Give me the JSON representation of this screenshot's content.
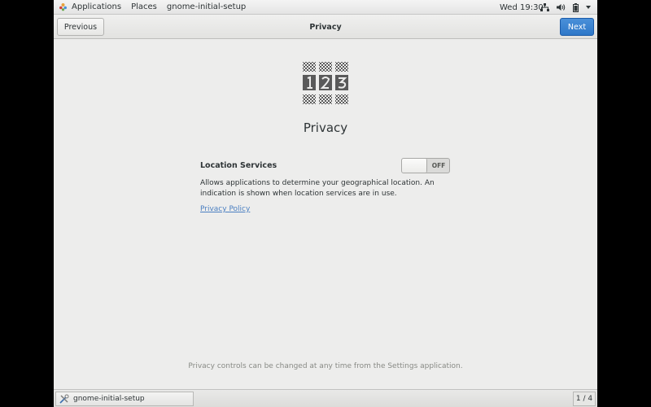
{
  "topbar": {
    "applications_label": "Applications",
    "places_label": "Places",
    "app_name": "gnome-initial-setup",
    "clock": "Wed 19:30"
  },
  "header": {
    "title": "Privacy",
    "previous_label": "Previous",
    "next_label": "Next"
  },
  "main": {
    "title": "Privacy",
    "location_services": {
      "label": "Location Services",
      "switch_state": "OFF",
      "description": "Allows applications to determine your geographical location. An indication is shown when location services are in use."
    },
    "privacy_policy_link": "Privacy Policy",
    "footer_note": "Privacy controls can be changed at any time from the Settings application."
  },
  "taskbar": {
    "window_item": "gnome-initial-setup",
    "workspace_indicator": "1 / 4"
  },
  "colors": {
    "accent": "#3584e4",
    "content_bg": "#ededec",
    "link": "#4a7fc1"
  }
}
